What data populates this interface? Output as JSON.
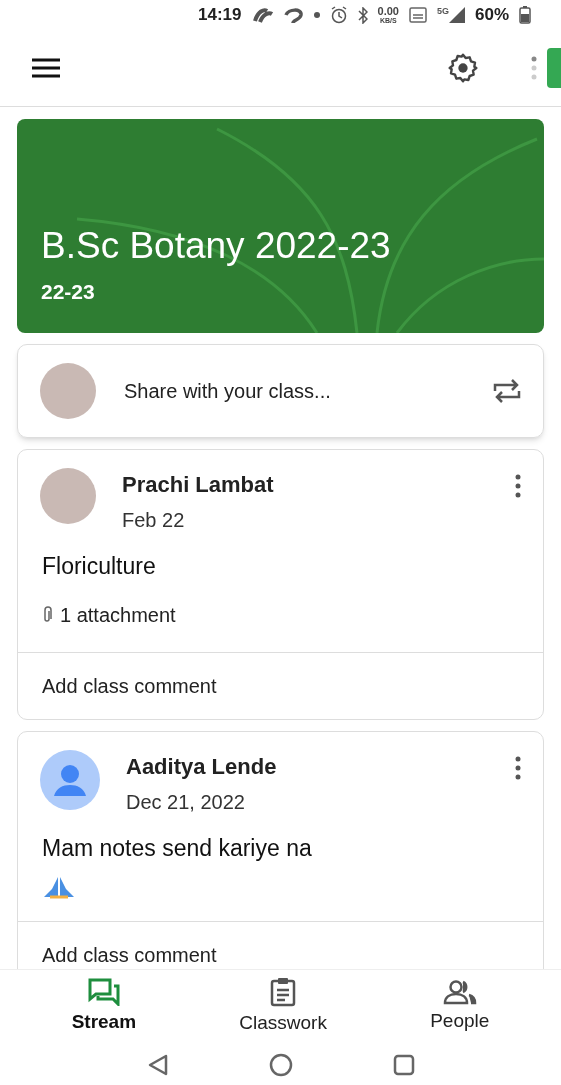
{
  "status_bar": {
    "time": "14:19",
    "speed": "0.00",
    "speed_unit": "KB/S",
    "network": "5G",
    "battery": "60%"
  },
  "class_banner": {
    "title": "B.Sc Botany 2022-23",
    "section": "22-23"
  },
  "share_box": {
    "placeholder": "Share with your class..."
  },
  "posts": [
    {
      "kind": "photo_avatar",
      "author": "Prachi Lambat",
      "date": "Feb 22",
      "body": "Floriculture",
      "attachment": "1 attachment",
      "emoji": false,
      "comment_prompt": "Add class comment"
    },
    {
      "kind": "default_avatar",
      "author": "Aaditya Lende",
      "date": "Dec 21, 2022",
      "body": "Mam notes send kariye na",
      "emoji": true,
      "comment_prompt": "Add class comment"
    }
  ],
  "bottom_nav": [
    {
      "label": "Stream",
      "kind": "stream",
      "selected": true
    },
    {
      "label": "Classwork",
      "kind": "classwork",
      "selected": false
    },
    {
      "label": "People",
      "kind": "people",
      "selected": false
    }
  ]
}
